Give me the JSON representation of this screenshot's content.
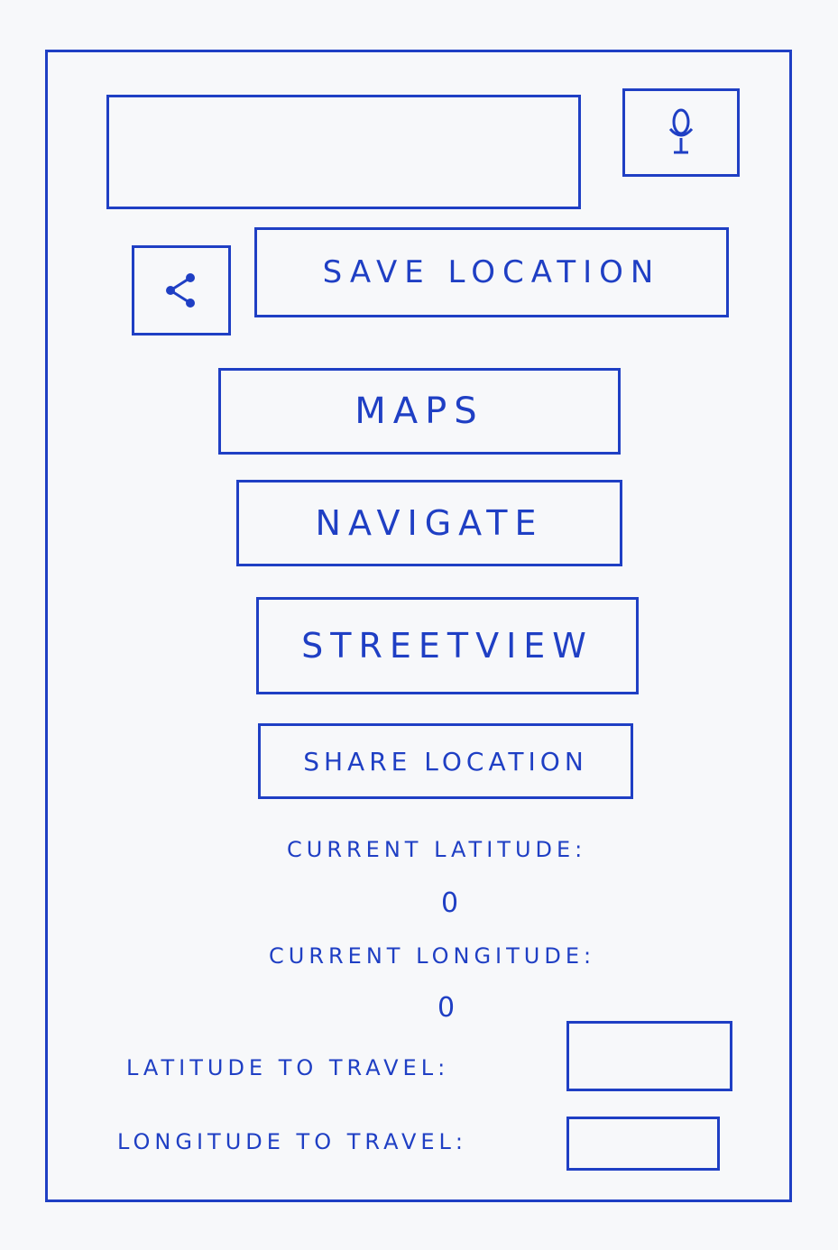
{
  "search": {
    "value": "",
    "placeholder": ""
  },
  "mic_icon": "microphone-icon",
  "share_icon": "share-icon",
  "buttons": {
    "save_location": "SAVE LOCATION",
    "maps": "MAPS",
    "navigate": "NAVIGATE",
    "streetview": "STREETVIEW",
    "share_location": "SHARE LOCATION"
  },
  "current": {
    "latitude_label": "CURRENT LATITUDE:",
    "latitude_value": "0",
    "longitude_label": "CURRENT LONGITUDE:",
    "longitude_value": "0"
  },
  "travel": {
    "latitude_label": "LATITUDE TO TRAVEL:",
    "latitude_value": "",
    "longitude_label": "LONGITUDE TO TRAVEL:",
    "longitude_value": ""
  },
  "colors": {
    "ink": "#1f3fc4",
    "paper": "#f7f8fa"
  }
}
